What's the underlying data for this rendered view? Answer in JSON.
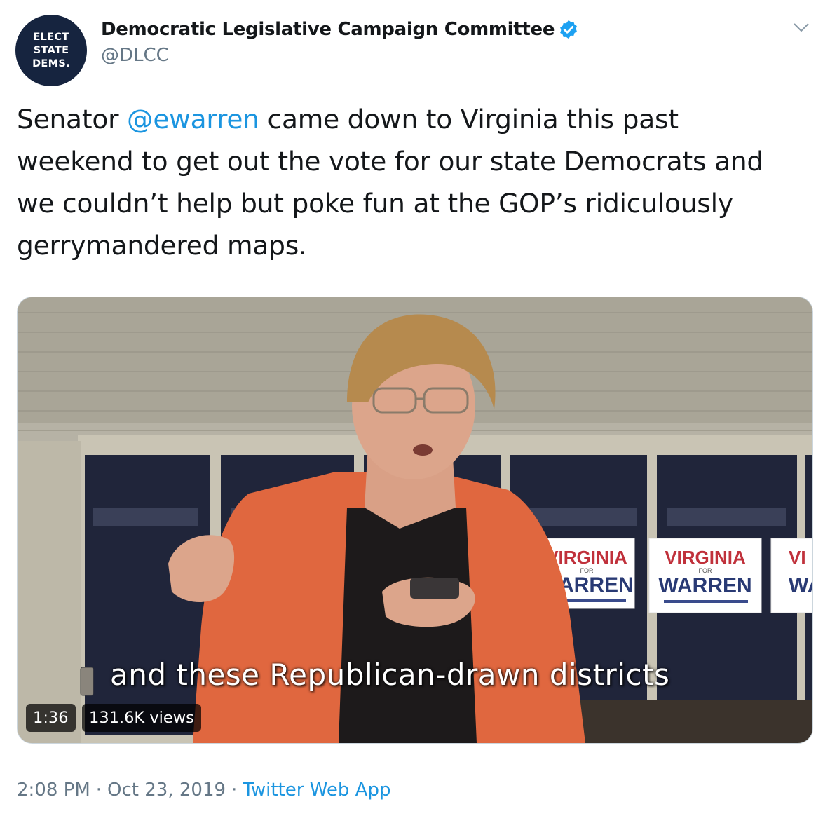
{
  "account": {
    "avatar_lines": [
      "ELECT",
      "STATE",
      "DEMS."
    ],
    "display_name": "Democratic Legislative Campaign Committee",
    "handle": "@DLCC",
    "verified": true
  },
  "menu_icon": "chevron-down-icon",
  "tweet": {
    "text_before": "Senator ",
    "mention": "@ewarren",
    "text_after": " came down to Virginia this past weekend to get out the vote for our state Democrats and we couldn’t help but poke fun at the GOP’s ridiculously gerrymandered maps."
  },
  "video": {
    "subtitle": "and these Republican-drawn districts",
    "duration": "1:36",
    "views": "131.6K views",
    "signs": [
      {
        "top": "VIRGINIA",
        "small": "FOR",
        "bottom": "WARREN"
      },
      {
        "top": "VIRGINIA",
        "small": "FOR",
        "bottom": "WARREN"
      },
      {
        "top": "VI",
        "bottom": "WA"
      }
    ]
  },
  "meta": {
    "time": "2:08 PM",
    "separator": "·",
    "date": "Oct 23, 2019",
    "source": "Twitter Web App"
  },
  "colors": {
    "link": "#1b95e0",
    "secondary_text": "#657786",
    "avatar_bg": "#16243f",
    "verified": "#1da1f2",
    "jacket": "#e0673f"
  }
}
